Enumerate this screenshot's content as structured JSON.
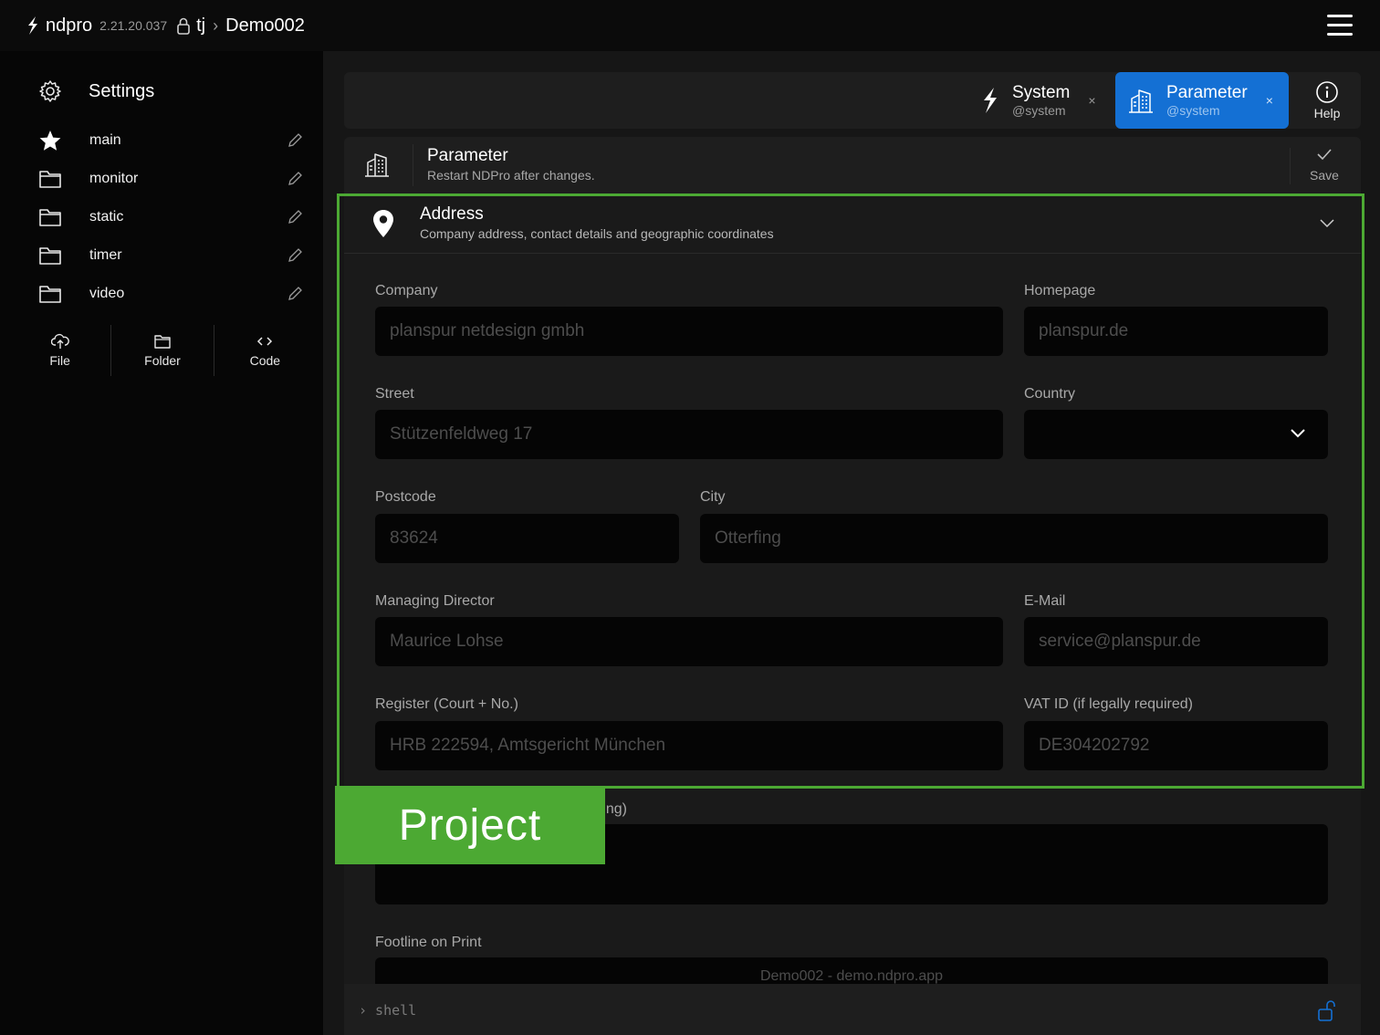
{
  "topbar": {
    "brand": "ndpro",
    "version": "2.21.20.037",
    "user": "tj",
    "separator": "›",
    "project": "Demo002"
  },
  "sidebar": {
    "title": "Settings",
    "items": [
      {
        "label": "main",
        "icon": "star-icon"
      },
      {
        "label": "monitor",
        "icon": "folder-icon"
      },
      {
        "label": "static",
        "icon": "folder-icon"
      },
      {
        "label": "timer",
        "icon": "folder-icon"
      },
      {
        "label": "video",
        "icon": "folder-icon"
      }
    ],
    "actions": [
      {
        "label": "File",
        "icon": "cloud-upload-icon"
      },
      {
        "label": "Folder",
        "icon": "folder-icon"
      },
      {
        "label": "Code",
        "icon": "code-icon"
      }
    ]
  },
  "tabs": [
    {
      "name": "System",
      "sub": "@system",
      "close": "×",
      "active": false
    },
    {
      "name": "Parameter",
      "sub": "@system",
      "close": "×",
      "active": true
    }
  ],
  "help_label": "Help",
  "param": {
    "title": "Parameter",
    "subtitle": "Restart NDPro after changes.",
    "save_label": "Save"
  },
  "address": {
    "title": "Address",
    "subtitle": "Company address, contact details and geographic coordinates",
    "fields": {
      "company": {
        "label": "Company",
        "value": "planspur netdesign gmbh"
      },
      "homepage": {
        "label": "Homepage",
        "value": "planspur.de"
      },
      "street": {
        "label": "Street",
        "value": "Stützenfeldweg 17"
      },
      "country": {
        "label": "Country",
        "value": ""
      },
      "postcode": {
        "label": "Postcode",
        "value": "83624"
      },
      "city": {
        "label": "City",
        "value": "Otterfing"
      },
      "director": {
        "label": "Managing Director",
        "value": "Maurice Lohse"
      },
      "email": {
        "label": "E-Mail",
        "value": "service@planspur.de"
      },
      "register": {
        "label": "Register (Court + No.)",
        "value": "HRB 222594, Amtsgericht München"
      },
      "vat": {
        "label": "VAT ID (if legally required)",
        "value": "DE304202792"
      },
      "partial": {
        "label": "ring)"
      },
      "footline": {
        "label": "Footline on Print",
        "value": "Demo002 - demo.ndpro.app"
      }
    }
  },
  "shell": {
    "prompt": "› shell"
  },
  "highlight": {
    "label": "Project",
    "color": "#4ca933"
  },
  "colors": {
    "accent": "#1470d4",
    "background": "#161616"
  }
}
